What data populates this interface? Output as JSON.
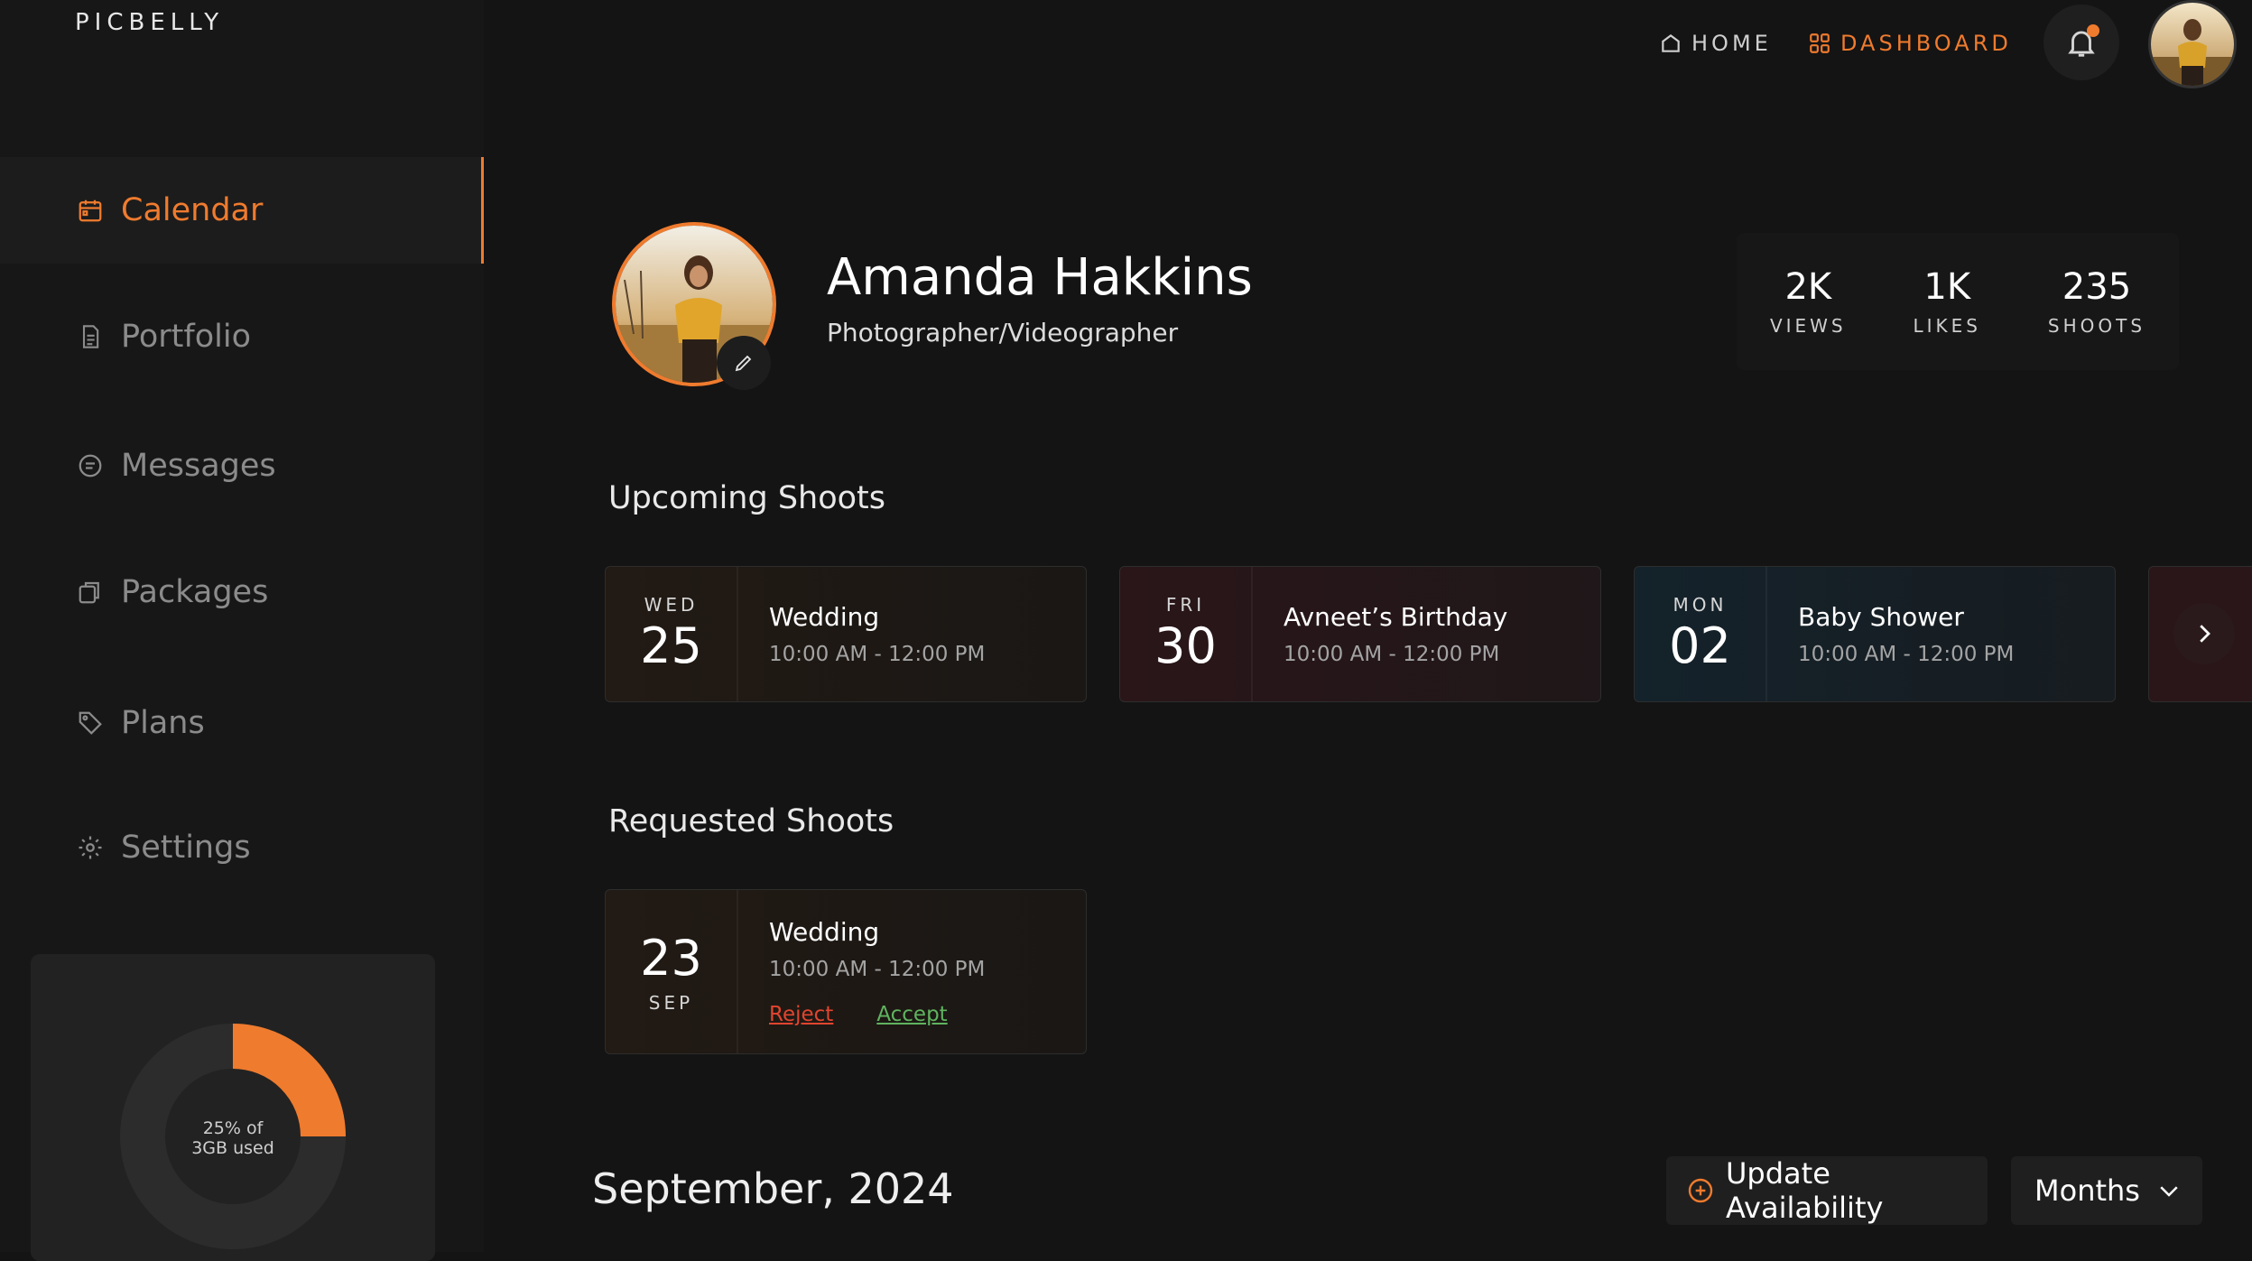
{
  "brand": "PICBELLY",
  "sidebar": {
    "items": [
      {
        "label": "Calendar",
        "icon": "calendar-icon",
        "active": true
      },
      {
        "label": "Portfolio",
        "icon": "document-icon"
      },
      {
        "label": "Messages",
        "icon": "message-icon"
      },
      {
        "label": "Packages",
        "icon": "package-icon"
      },
      {
        "label": "Plans",
        "icon": "tag-icon"
      },
      {
        "label": "Settings",
        "icon": "gear-icon"
      }
    ],
    "storage": {
      "line1": "25% of",
      "line2": "3GB used",
      "used_fraction": 0.25
    }
  },
  "topnav": {
    "home": "HOME",
    "dashboard": "DASHBOARD"
  },
  "profile": {
    "name": "Amanda Hakkins",
    "role": "Photographer/Videographer",
    "stats": [
      {
        "value": "2K",
        "label": "VIEWS"
      },
      {
        "value": "1K",
        "label": "LIKES"
      },
      {
        "value": "235",
        "label": "SHOOTS"
      }
    ]
  },
  "upcoming": {
    "title": "Upcoming Shoots",
    "items": [
      {
        "dow": "WED",
        "day": "25",
        "title": "Wedding",
        "time": "10:00 AM - 12:00 PM"
      },
      {
        "dow": "FRI",
        "day": "30",
        "title": "Avneet’s Birthday",
        "time": "10:00 AM - 12:00 PM"
      },
      {
        "dow": "MON",
        "day": "02",
        "title": "Baby Shower",
        "time": "10:00 AM - 12:00 PM"
      }
    ]
  },
  "requested": {
    "title": "Requested Shoots",
    "items": [
      {
        "day": "23",
        "month": "SEP",
        "title": "Wedding",
        "time": "10:00 AM - 12:00 PM",
        "reject": "Reject",
        "accept": "Accept"
      }
    ]
  },
  "calendar": {
    "month_title": "September, 2024",
    "update_label": "Update Availability",
    "view_select": "Months"
  },
  "colors": {
    "accent": "#ef7b2e",
    "reject": "#e0452f",
    "accept": "#5fb35f"
  }
}
